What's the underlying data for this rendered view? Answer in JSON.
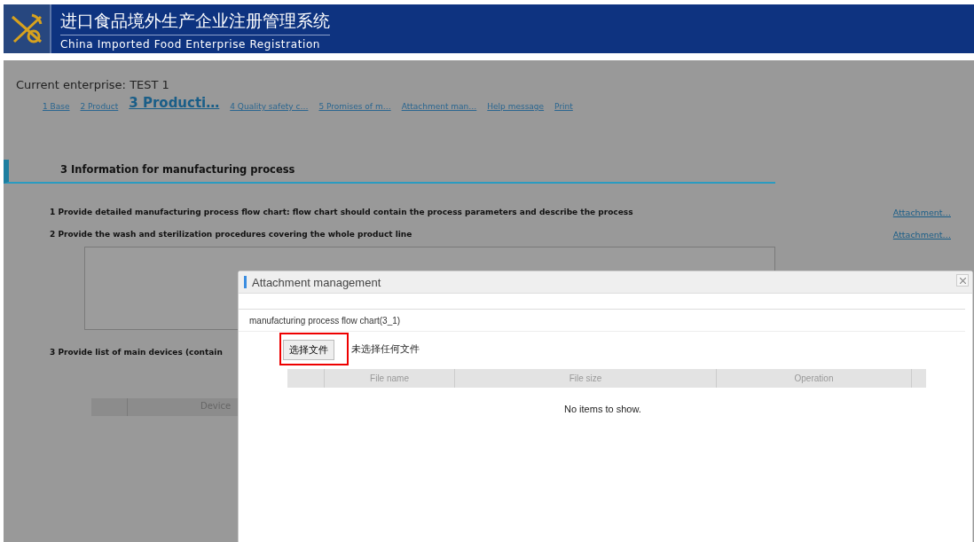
{
  "header": {
    "title_cn": "进口食品境外生产企业注册管理系统",
    "title_en": "China Imported Food Enterprise Registration"
  },
  "current_enterprise": "Current enterprise: TEST 1",
  "tabs": [
    {
      "label": "1 Base",
      "selected": false
    },
    {
      "label": "2 Product",
      "selected": false
    },
    {
      "label": "3 Producti…",
      "selected": true
    },
    {
      "label": "4 Quality safety c…",
      "selected": false
    },
    {
      "label": "5 Promises of m…",
      "selected": false
    },
    {
      "label": "Attachment man…",
      "selected": false
    },
    {
      "label": "Help message",
      "selected": false
    },
    {
      "label": "Print",
      "selected": false
    }
  ],
  "section": {
    "title": "3 Information for manufacturing process",
    "items": [
      {
        "text": "1 Provide detailed manufacturing process flow chart: flow chart should contain the process parameters and describe the process",
        "link": "Attachment…"
      },
      {
        "text": "2 Provide the wash and sterilization procedures covering the whole product line",
        "link": "Attachment…"
      }
    ],
    "item3": "3 Provide list of main devices (contain",
    "device_column": "Device"
  },
  "modal": {
    "title": "Attachment management",
    "subtitle": "manufacturing process flow chart(3_1)",
    "choose_button": "选择文件",
    "no_file": "未选择任何文件",
    "columns": [
      "File name",
      "File size",
      "Operation"
    ],
    "empty": "No items to show."
  }
}
